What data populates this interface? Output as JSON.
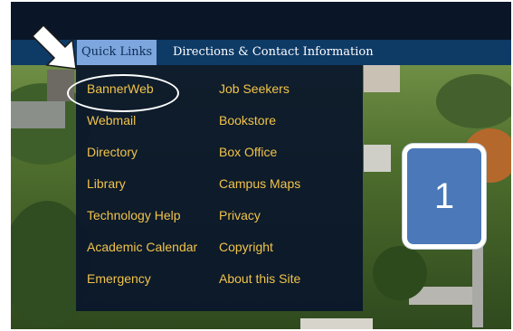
{
  "nav": {
    "quick_links": "Quick Links",
    "directions": "Directions & Contact Information"
  },
  "quick_links_menu": {
    "column1": [
      "BannerWeb",
      "Webmail",
      "Directory",
      "Library",
      "Technology Help",
      "Academic Calendar",
      "Emergency"
    ],
    "column2": [
      "Job Seekers",
      "Bookstore",
      "Box Office",
      "Campus Maps",
      "Privacy",
      "Copyright",
      "About this Site"
    ]
  },
  "annotation": {
    "callout_number": "1",
    "arrow": "arrow-icon"
  },
  "colors": {
    "nav_bar": "#0e3a66",
    "active_tab": "#7ea6de",
    "link": "#f2c34a",
    "callout": "#4a78b8"
  }
}
